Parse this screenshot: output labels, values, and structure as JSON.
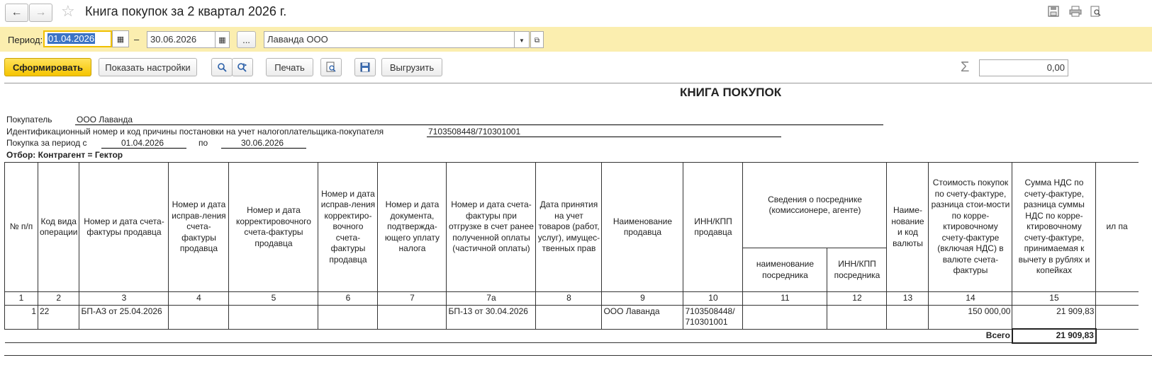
{
  "window": {
    "title": "Книга покупок за 2 квартал 2026 г."
  },
  "filter": {
    "period_label": "Период:",
    "date_from": "01.04.2026",
    "dash": "–",
    "date_to": "30.06.2026",
    "ellipsis": "...",
    "organization": "Лаванда ООО"
  },
  "toolbar": {
    "generate": "Сформировать",
    "show_settings": "Показать настройки",
    "print": "Печать",
    "export": "Выгрузить",
    "sum_value": "0,00"
  },
  "report": {
    "heading": "КНИГА ПОКУПОК",
    "buyer_label": "Покупатель",
    "buyer_value": "ООО Лаванда",
    "inn_label": "Идентификационный номер и код причины постановки на учет налогоплательщика-покупателя",
    "inn_value": "7103508448/710301001",
    "period_from_label": "Покупка за период с",
    "period_from_value": "01.04.2026",
    "period_to_label": "по",
    "period_to_value": "30.06.2026",
    "selection": "Отбор: Контрагент = Гектор"
  },
  "table": {
    "headers": {
      "c1": "№ п/п",
      "c2": "Код вида операции",
      "c3": "Номер и дата счета-фактуры продавца",
      "c4": "Номер и дата исправ-ления счета-фактуры продавца",
      "c5": "Номер и дата корректировочного счета-фактуры продавца",
      "c6": "Номер и дата исправ-ления корректиро-вочного счета-фактуры продавца",
      "c7": "Номер и дата документа, подтвержда-ющего уплату налога",
      "c7a": "Номер и дата счета-фактуры при отгрузке в счет ранее полученной оплаты (частичной оплаты)",
      "c8": "Дата принятия на учет товаров (работ, услуг), имущес-твенных прав",
      "c9": "Наименование продавца",
      "c10": "ИНН/КПП продавца",
      "c11_12": "Сведения о посреднике (комиссионере, агенте)",
      "c11": "наименование посредника",
      "c12": "ИНН/КПП посредника",
      "c13": "Наиме-нование и код валюты",
      "c14": "Стоимость покупок по счету-фактуре, разница стои-мости по корре-ктировочному счету-фактуре (включая НДС) в валюте счета-фактуры",
      "c15": "Сумма НДС по счету-фактуре, разница суммы НДС по корре-ктировочному счету-фактуре, принимаемая к вычету в рублях и копейках",
      "c16_partial": "ил па"
    },
    "col_numbers": [
      "1",
      "2",
      "3",
      "4",
      "5",
      "6",
      "7",
      "7а",
      "8",
      "9",
      "10",
      "11",
      "12",
      "13",
      "14",
      "15",
      ""
    ],
    "rows": [
      {
        "n": "1",
        "op_code": "22",
        "invoice": "БП-АЗ от 25.04.2026",
        "fix": "",
        "corr": "",
        "corr_fix": "",
        "pay_doc": "",
        "advance_invoice": "БП-13 от 30.04.2026",
        "accept_date": "",
        "seller": "ООО Лаванда",
        "seller_inn": "7103508448/ 710301001",
        "agent_name": "",
        "agent_inn": "",
        "currency": "",
        "amount": "150 000,00",
        "vat": "21 909,83"
      }
    ],
    "total_label": "Всего",
    "total_vat": "21 909,83"
  }
}
